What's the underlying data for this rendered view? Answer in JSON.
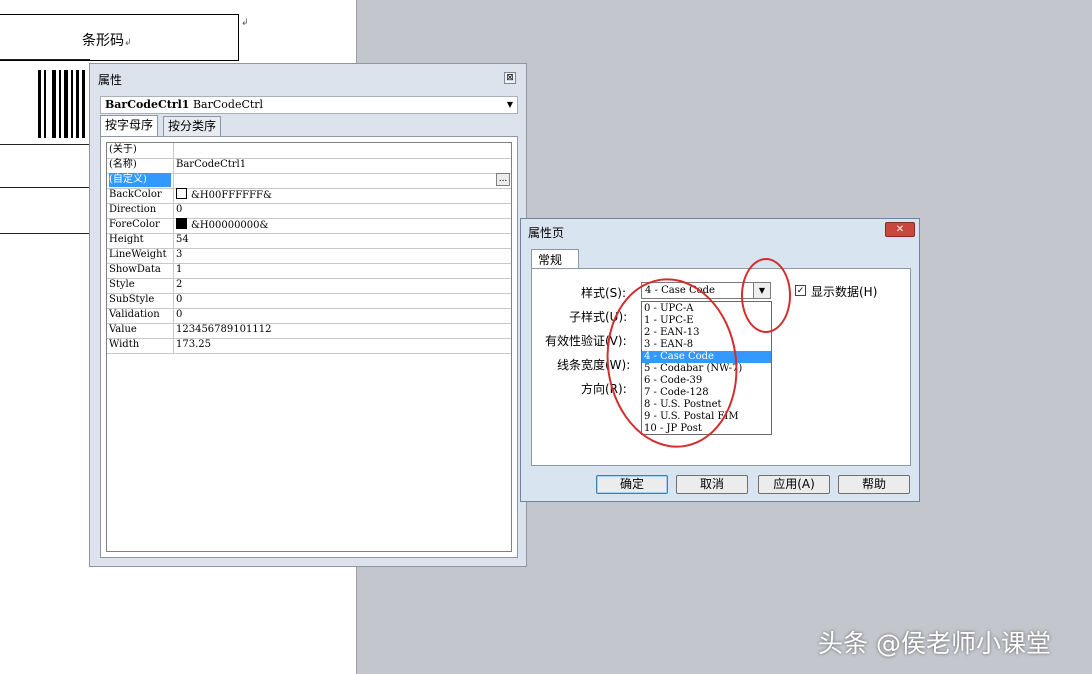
{
  "document": {
    "cell_text": "条形码",
    "pilcrow": "↲"
  },
  "properties_window": {
    "title": "属性",
    "close_glyph": "⊠",
    "object_name": "BarCodeCtrl1",
    "object_type": "BarCodeCtrl",
    "tabs": [
      "按字母序",
      "按分类序"
    ],
    "rows": [
      {
        "name": "(关于)",
        "value": ""
      },
      {
        "name": "(名称)",
        "value": "BarCodeCtrl1"
      },
      {
        "name": "(自定义)",
        "value": "",
        "button": "..."
      },
      {
        "name": "BackColor",
        "value": "&H00FFFFFF&",
        "swatch": "#ffffff"
      },
      {
        "name": "Direction",
        "value": "0"
      },
      {
        "name": "ForeColor",
        "value": "&H00000000&",
        "swatch": "#000000"
      },
      {
        "name": "Height",
        "value": "54"
      },
      {
        "name": "LineWeight",
        "value": "3"
      },
      {
        "name": "ShowData",
        "value": "1"
      },
      {
        "name": "Style",
        "value": "2"
      },
      {
        "name": "SubStyle",
        "value": "0"
      },
      {
        "name": "Validation",
        "value": "0"
      },
      {
        "name": "Value",
        "value": "123456789101112"
      },
      {
        "name": "Width",
        "value": "173.25"
      }
    ]
  },
  "property_pages": {
    "title": "属性页",
    "close_glyph": "✕",
    "tab": "常规",
    "labels": {
      "style": "样式(S):",
      "substyle": "子样式(U):",
      "validation": "有效性验证(V):",
      "line_width": "线条宽度(W):",
      "direction": "方向(R):"
    },
    "style_value": "4 - Case Code",
    "combo_arrow": "▼",
    "show_data_label": "显示数据(H)",
    "show_data_checked": "✓",
    "style_options": [
      "0 - UPC-A",
      "1 - UPC-E",
      "2 - EAN-13",
      "3 - EAN-8",
      "4 - Case Code",
      "5 - Codabar (NW-7)",
      "6 - Code-39",
      "7 - Code-128",
      "8 - U.S. Postnet",
      "9 - U.S. Postal FIM",
      "10 - JP Post"
    ],
    "selected_option": "4 - Case Code",
    "buttons": {
      "ok": "确定",
      "cancel": "取消",
      "apply": "应用(A)",
      "help": "帮助"
    }
  },
  "annotation_color": "#d42d2d",
  "watermark": "头条 @侯老师小课堂"
}
